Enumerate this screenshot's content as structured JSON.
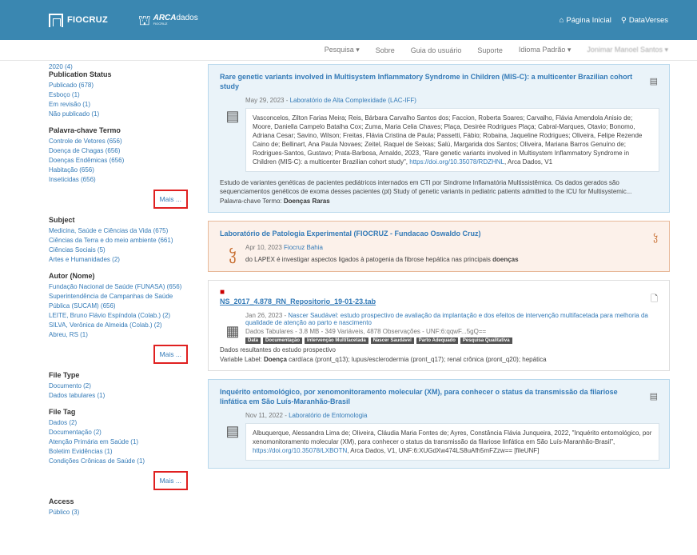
{
  "header": {
    "brand": "FIOCRUZ",
    "arca": "ARCA",
    "arca_dados": "dados",
    "arca_sub": "FIOCRUZ",
    "home": "Página Inicial",
    "dataverses": "DataVerses"
  },
  "navbar": {
    "items": [
      "Pesquisa ▾",
      "Sobre",
      "Guia do usuário",
      "Suporte",
      "Idioma Padrão ▾"
    ],
    "user": "Jonimar Manoel Santos ▾"
  },
  "sidebar": {
    "year": "2020 (4)",
    "facets": [
      {
        "title": "Publication Status",
        "items": [
          "Publicado (678)",
          "Esboço (1)",
          "Em revisão (1)",
          "Não publicado (1)"
        ],
        "more": ""
      },
      {
        "title": "Palavra-chave Termo",
        "items": [
          "Controle de Vetores (656)",
          "Doença de Chagas (656)",
          "Doenças Endêmicas (656)",
          "Habitação (656)",
          "Inseticidas (656)"
        ],
        "more": "Mais ..."
      },
      {
        "title": "Subject",
        "items": [
          "Medicina, Saúde e Ciências da Vida (675)",
          "Ciências da Terra e do meio ambiente (661)",
          "Ciências Sociais (5)",
          "Artes e Humanidades (2)"
        ],
        "more": ""
      },
      {
        "title": "Autor (Nome)",
        "items": [
          "Fundação Nacional de Saúde (FUNASA) (656)",
          "Superintendência de Campanhas de Saúde Pública (SUCAM) (656)",
          "LEITE, Bruno Flávio Espíndola (Colab.) (2)",
          "SILVA, Verônica de Almeida (Colab.) (2)",
          "Abreu, RS (1)"
        ],
        "more": "Mais ..."
      },
      {
        "title": "File Type",
        "items": [
          "Documento (2)",
          "Dados tabulares (1)"
        ],
        "more": ""
      },
      {
        "title": "File Tag",
        "items": [
          "Dados (2)",
          "Documentação (2)",
          "Atenção Primária em Saúde (1)",
          "Boletim Evidências (1)",
          "Condições Crônicas de Saúde (1)"
        ],
        "more": "Mais ..."
      },
      {
        "title": "Access",
        "items": [
          "Público (3)"
        ],
        "more": ""
      }
    ]
  },
  "results": [
    {
      "title": "Rare genetic variants involved in Multisystem Inflammatory Syndrome in Children (MIS-C): a multicenter Brazilian cohort study",
      "date": "May 29, 2023 - ",
      "source": "Laboratório de Alta Complexidade (LAC-IFF)",
      "citation": "Vasconcelos, Zilton Farias Meira; Reis, Bárbara Carvalho Santos dos; Faccion, Roberta Soares; Carvalho, Flávia Amendola Anisio de; Moore, Daniella Campelo Batalha Cox; Zuma, Maria Celia Chaves; Plaça, Desirée Rodrigues Plaça; Cabral-Marques, Otavio; Bonomo, Adriana Cesar; Savino, Wilson; Freitas, Flávia Cristina de Paula; Passetti, Fábio; Robaina, Jaqueline Rodrigues; Oliveira, Felipe Rezende Caino de; Bellinart, Ana Paula Novaes; Zeitel, Raquel de Seixas; Salú, Margarida dos Santos; Oliveira, Mariana Barros Genuíno de; Rodrigues-Santos, Gustavo; Prata-Barbosa, Arnaldo, 2023, \"Rare genetic variants involved in Multisystem Inflammatory Syndrome in Children (MIS-C): a multicenter Brazilian cohort study\", ",
      "doi": "https://doi.org/10.35078/RDZHNL",
      "cite_tail": ", Arca Dados, V1",
      "description": "Estudo de variantes genéticas de pacientes pediátricos internados em CTI por Síndrome Inflamatória Multissistêmica. Os dados gerados são sequenciamentos genéticos de exoma desses pacientes (pt) Study of genetic variants in pediatric patients admitted to the ICU for Multisystemic...",
      "kw_label": "Palavra-chave Termo: ",
      "kw": "Doenças Raras"
    },
    {
      "title": "Laboratório de Patologia Experimental",
      "title_suffix": " (FIOCRUZ - Fundacao Oswaldo Cruz)",
      "date": "Apr 10, 2023 ",
      "source": "Fiocruz Bahia",
      "description": "do LAPEX é investigar aspectos ligados à patogenia da fibrose hepática nas principais ",
      "desc_bold": "doenças"
    },
    {
      "title": "NS_2017_4.878_RN_Repositorio_19-01-23.tab",
      "date": "Jan 26, 2023 - ",
      "source": "Nascer Saudável: estudo prospectivo de avaliação da implantação e dos efeitos de intervenção multifacetada para melhoria da qualidade de atenção ao parto e nascimento",
      "info": "Dados Tabulares - 3.8 MB - 349 Variáveis, 4878 Observações - UNF:6:qqwF...5gQ== ",
      "tags": [
        "Data",
        "Documentação",
        "Intervenção Multifacetada",
        "Nascer Saudável",
        "Parto Adequado",
        "Pesquisa Qualitativa"
      ],
      "description": "Dados resultantes do estudo prospectivo",
      "var_label": "Variable Label: ",
      "var_bold": "Doença",
      "var_rest": " cardíaca (pront_q13); lupus/esclerodermia (pront_q17); renal crônica (pront_q20); hepática"
    },
    {
      "title": "Inquérito entomológico, por xenomonitoramento molecular (XM), para conhecer o status da transmissão da filariose linfática em São Luís-Maranhão-Brasil",
      "date": "Nov 11, 2022 - ",
      "source": "Laboratório de Entomologia",
      "citation": "Albuquerque, Alessandra Lima de; Oliveira, Cláudia Maria Fontes de; Ayres, Constância Flávia Junqueira, 2022, \"Inquérito entomológico, por xenomonitoramento molecular (XM), para conhecer o status da transmissão da filariose linfática em São Luís-Maranhão-Brasil\", ",
      "doi": "https://doi.org/10.35078/LXBOTN",
      "cite_tail": ", Arca Dados, V1, UNF:6:XUGdXw474LS8uAfh5mFZzw== [fileUNF]"
    }
  ]
}
